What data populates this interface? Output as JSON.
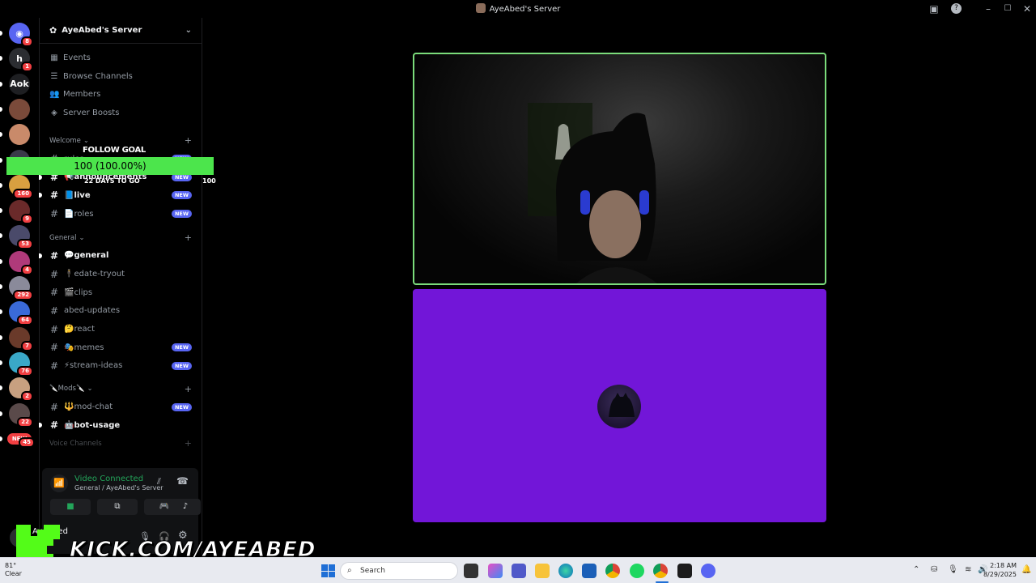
{
  "window": {
    "title": "AyeAbed's Server"
  },
  "rail": {
    "items": [
      {
        "label": "",
        "badge": "8"
      },
      {
        "label": "h",
        "badge": "1"
      },
      {
        "label": "Aok",
        "badge": ""
      },
      {
        "label": "",
        "badge": ""
      },
      {
        "label": "",
        "badge": ""
      },
      {
        "label": "",
        "badge": ""
      },
      {
        "label": "",
        "badge": "160"
      },
      {
        "label": "",
        "badge": "9"
      },
      {
        "label": "",
        "badge": "53"
      },
      {
        "label": "",
        "badge": "4"
      },
      {
        "label": "",
        "badge": "292"
      },
      {
        "label": "",
        "badge": "64"
      },
      {
        "label": "",
        "badge": "7"
      },
      {
        "label": "",
        "badge": "76"
      },
      {
        "label": "",
        "badge": "2"
      },
      {
        "label": "",
        "badge": "22"
      },
      {
        "label": "NEW",
        "badge": "45"
      }
    ]
  },
  "server": {
    "name": "AyeAbed's Server"
  },
  "menu": [
    "Events",
    "Browse Channels",
    "Members",
    "Server Boosts"
  ],
  "categories": {
    "welcome": "Welcome",
    "general": "General",
    "mods": "🔪Mods🔪",
    "voice": "Voice Channels"
  },
  "channels": {
    "welcome": [
      {
        "name": "rules",
        "new": "NEW",
        "unread": false
      },
      {
        "name": "📢announcements",
        "new": "NEW",
        "unread": true
      },
      {
        "name": "📘live",
        "new": "NEW",
        "unread": true
      },
      {
        "name": "📄roles",
        "new": "NEW",
        "unread": false
      }
    ],
    "general": [
      {
        "name": "💬general",
        "new": "",
        "unread": true
      },
      {
        "name": "🕴edate-tryout",
        "new": "",
        "unread": false
      },
      {
        "name": "🎬clips",
        "new": "",
        "unread": false
      },
      {
        "name": "abed-updates",
        "new": "",
        "unread": false
      },
      {
        "name": "🤔react",
        "new": "",
        "unread": false
      },
      {
        "name": "🎭memes",
        "new": "NEW",
        "unread": false
      },
      {
        "name": "⚡stream-ideas",
        "new": "NEW",
        "unread": false
      }
    ],
    "mods": [
      {
        "name": "🔱mod-chat",
        "new": "NEW",
        "unread": false
      },
      {
        "name": "🤖bot-usage",
        "new": "",
        "unread": true
      }
    ]
  },
  "voice": {
    "status": "Video Connected",
    "location": "General / AyeAbed's Server"
  },
  "user": {
    "name": "AyeAbed"
  },
  "goal": {
    "title": "FOLLOW GOAL",
    "value_text": "100 (100.00%)",
    "days": "22 DAYS TO GO",
    "target": "100",
    "progress": 1.0,
    "color": "#4ce54c"
  },
  "kick": {
    "text": "KICK.COM/AYEABED",
    "color": "#53fc18"
  },
  "stage": {
    "tile2_color": "#7216d8",
    "tile1_border": "#7bdc7b"
  },
  "taskbar": {
    "search": "Search",
    "time": "2:18 AM",
    "date": "8/29/2025",
    "weather_temp": "81°",
    "weather_text": "Clear"
  }
}
